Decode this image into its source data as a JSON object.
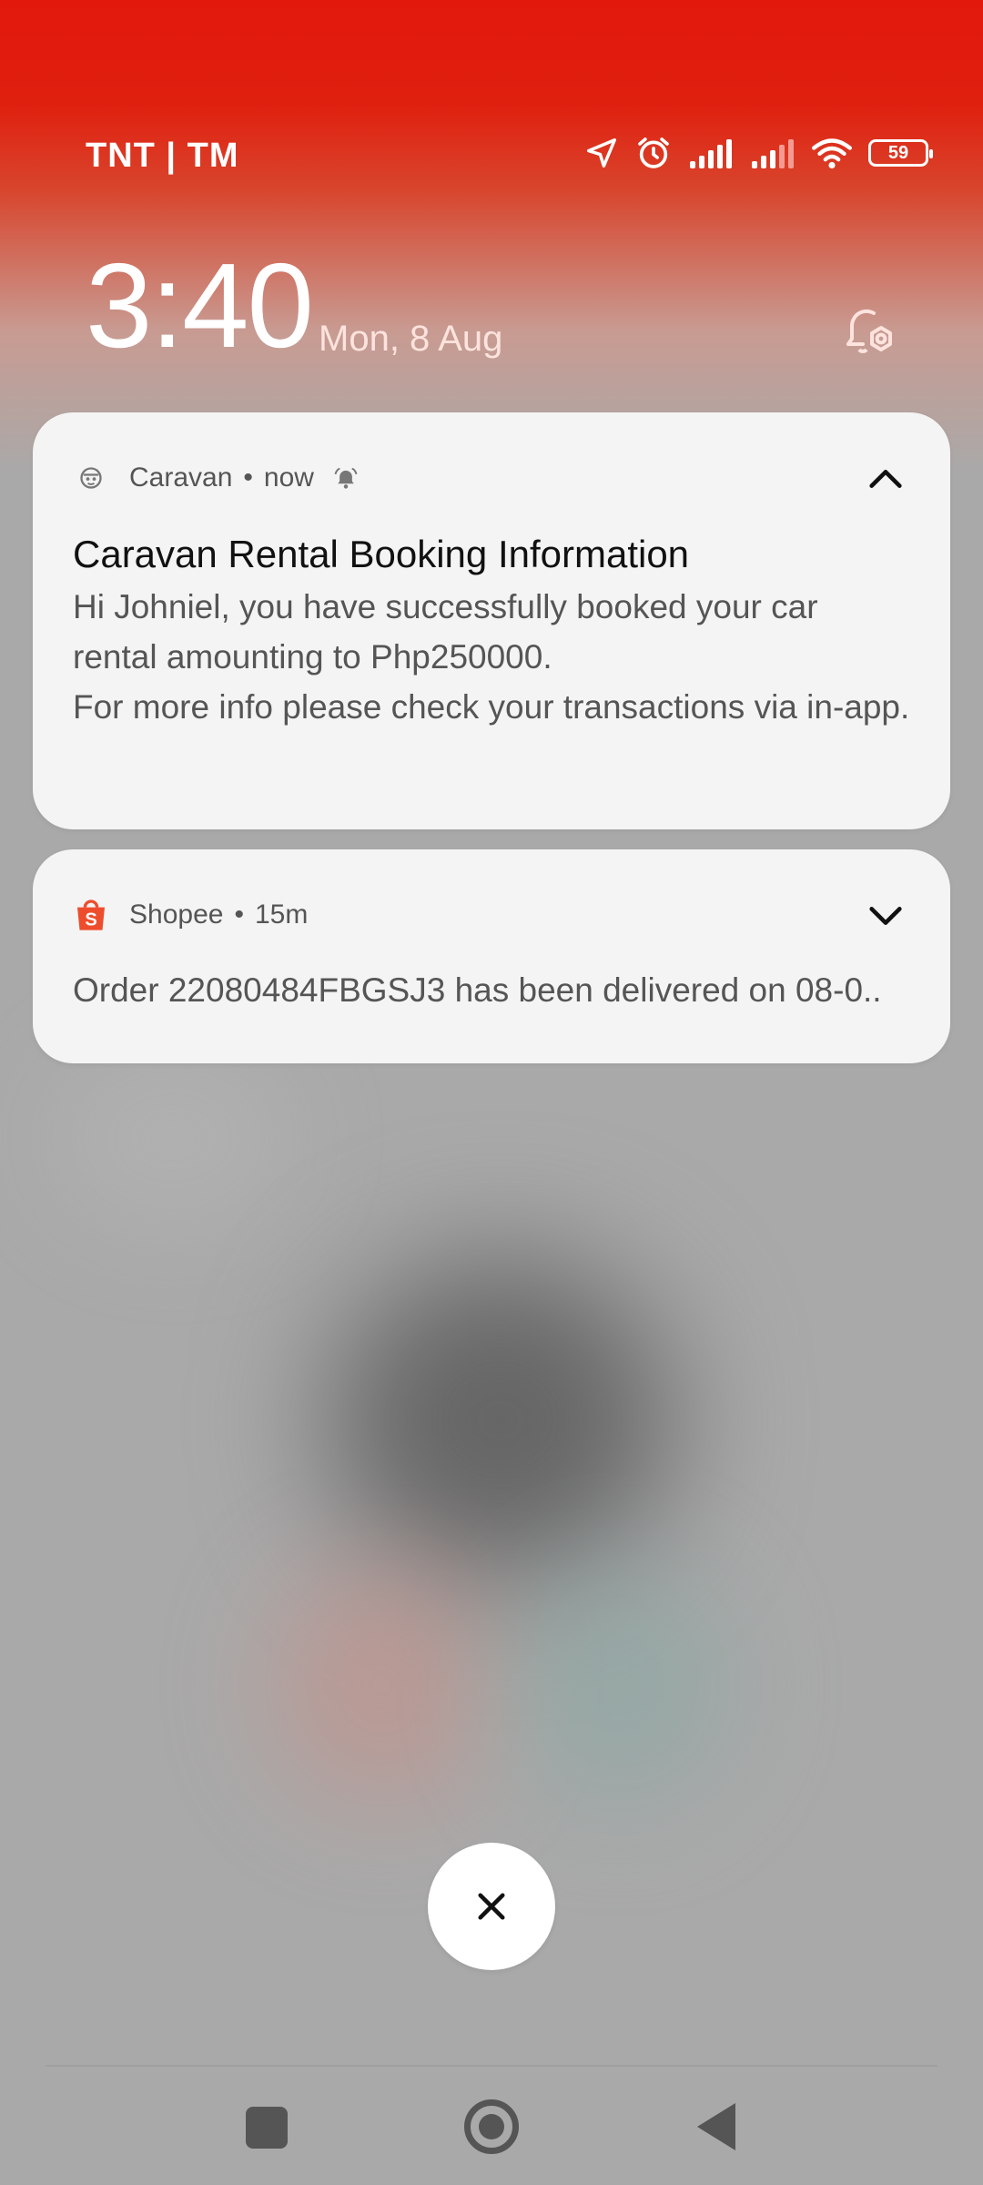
{
  "status_bar": {
    "carrier": "TNT | TM",
    "battery": "59",
    "icons": [
      "location-icon",
      "alarm-icon",
      "signal-icon",
      "signal-icon",
      "wifi-icon",
      "battery-icon"
    ]
  },
  "lockscreen": {
    "time": "3:40",
    "date": "Mon, 8 Aug"
  },
  "notifications": [
    {
      "app": "Caravan",
      "time": "now",
      "title": "Caravan Rental Booking Information",
      "body_line1": "Hi Johniel, you have successfully booked your car rental amounting to Php250000.",
      "body_line2": "For more info please check your transactions via in-app.",
      "expanded": true
    },
    {
      "app": "Shopee",
      "time": "15m",
      "text": "Order 22080484FBGSJ3 has been delivered on 08-0..",
      "expanded": false,
      "icon_color": "#ee4d2d"
    }
  ],
  "colors": {
    "accent_red": "#e2180d",
    "card_bg": "#f4f4f4",
    "nav_gray": "#555555"
  }
}
